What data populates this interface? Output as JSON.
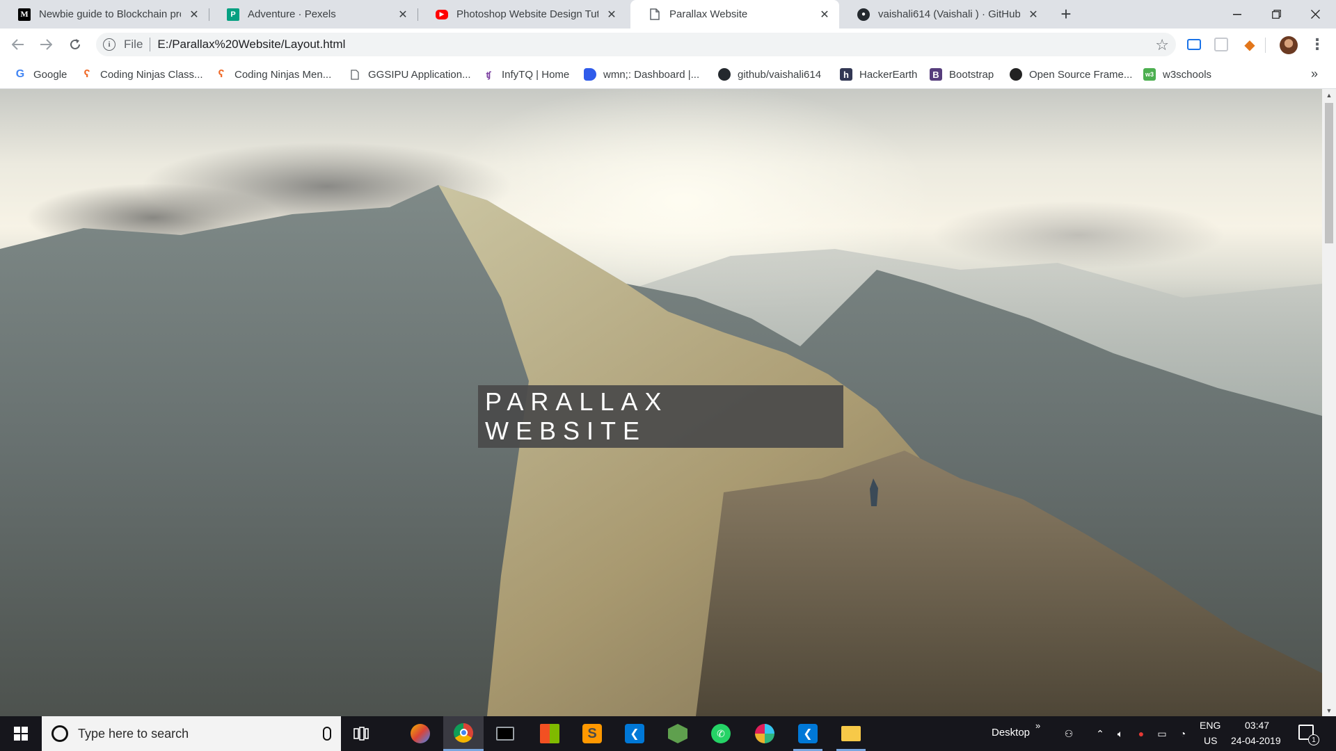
{
  "browser": {
    "tabs": [
      {
        "title": "Newbie guide to Blockchain prog",
        "icon": "medium-icon",
        "active": false
      },
      {
        "title": "Adventure · Pexels",
        "icon": "pexels-icon",
        "active": false
      },
      {
        "title": "Photoshop Website Design Tutor",
        "icon": "youtube-icon",
        "active": false
      },
      {
        "title": "Parallax Website",
        "icon": "page-icon",
        "active": true
      },
      {
        "title": "vaishali614 (Vaishali ) · GitHub",
        "icon": "github-icon",
        "active": false
      }
    ],
    "new_tab_symbol": "+",
    "address": {
      "scheme_label": "File",
      "url": "E:/Parallax%20Website/Layout.html"
    },
    "bookmarks": [
      {
        "label": "Google",
        "icon": "google-icon"
      },
      {
        "label": "Coding Ninjas Class...",
        "icon": "coding-ninjas-icon"
      },
      {
        "label": "Coding Ninjas Men...",
        "icon": "coding-ninjas-icon"
      },
      {
        "label": "GGSIPU Application...",
        "icon": "page-icon"
      },
      {
        "label": "InfyTQ | Home",
        "icon": "infytq-icon"
      },
      {
        "label": "wmn;: Dashboard |...",
        "icon": "wmn-icon"
      },
      {
        "label": "github/vaishali614",
        "icon": "github-icon"
      },
      {
        "label": "HackerEarth",
        "icon": "hackerearth-icon"
      },
      {
        "label": "Bootstrap",
        "icon": "bootstrap-icon"
      },
      {
        "label": "Open Source Frame...",
        "icon": "opensource-icon"
      },
      {
        "label": "w3schools",
        "icon": "w3schools-icon"
      }
    ],
    "bookmarks_more": "»"
  },
  "page": {
    "hero_title": "PARALLAX WEBSITE"
  },
  "taskbar": {
    "search_placeholder": "Type here to search",
    "apps": [
      "paint-icon",
      "chrome-icon",
      "terminal-icon",
      "windows-store-icon",
      "sublime-icon",
      "vscode-icon",
      "node-icon",
      "whatsapp-icon",
      "slack-icon",
      "vscode-icon",
      "file-explorer-icon"
    ],
    "desktop_label": "Desktop",
    "desktop_chevron": "»",
    "language_top": "ENG",
    "language_bottom": "US",
    "time": "03:47",
    "date": "24-04-2019",
    "notification_count": "1"
  },
  "colors": {
    "hero_box": "#4a4a4a",
    "tab_strip": "#dee1e6",
    "taskbar": "#16161c",
    "accent": "#1a73e8"
  }
}
